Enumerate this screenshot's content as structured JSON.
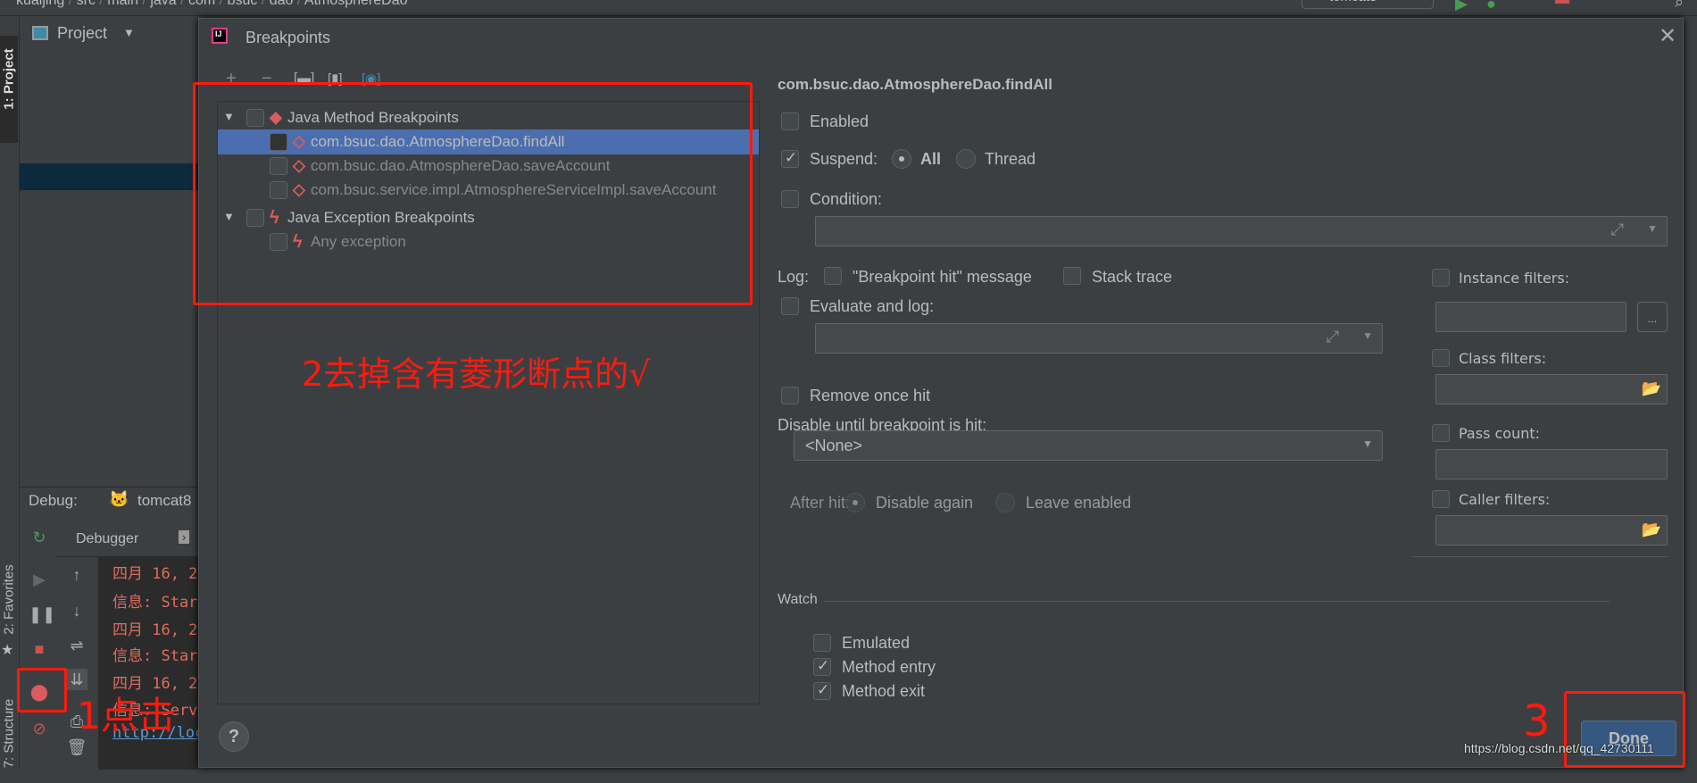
{
  "topbar": {
    "breadcrumb": [
      "kuaijing",
      "src",
      "main",
      "java",
      "com",
      "bsuc",
      "dao",
      "AtmosphereDao"
    ],
    "run_config": "tomcat8"
  },
  "left_stripe": {
    "project": "1: Project",
    "favorites": "2: Favorites",
    "structure": "7: Structure"
  },
  "project_panel": {
    "title": "Project"
  },
  "debug": {
    "label": "Debug:",
    "config": "tomcat8",
    "tab": "Debugger",
    "console": [
      "四月 16, 2",
      "信息: Star",
      "四月 16, 2",
      "信息: Star",
      "四月 16, 2",
      "信息: Serv",
      "http://loc"
    ]
  },
  "dialog": {
    "title": "Breakpoints",
    "tree": [
      {
        "label": "Java Method Breakpoints",
        "type": "group",
        "icon": "diamond-filled-icon",
        "checked": false
      },
      {
        "label": "com.bsuc.dao.AtmosphereDao.findAll",
        "type": "item",
        "icon": "diamond-outline-icon",
        "checked": false,
        "selected": true
      },
      {
        "label": "com.bsuc.dao.AtmosphereDao.saveAccount",
        "type": "item",
        "icon": "diamond-outline-icon",
        "checked": false
      },
      {
        "label": "com.bsuc.service.impl.AtmosphereServiceImpl.saveAccount",
        "type": "item",
        "icon": "diamond-outline-icon",
        "checked": false
      },
      {
        "label": "Java Exception Breakpoints",
        "type": "group",
        "icon": "lightning-icon",
        "checked": false
      },
      {
        "label": "Any exception",
        "type": "item",
        "icon": "lightning-icon",
        "checked": false
      }
    ],
    "detail": {
      "title": "com.bsuc.dao.AtmosphereDao.findAll",
      "enabled": "Enabled",
      "suspend": "Suspend:",
      "all": "All",
      "thread": "Thread",
      "condition": "Condition:",
      "log": "Log:",
      "bp_hit": "\"Breakpoint hit\" message",
      "stack_trace": "Stack trace",
      "evaluate": "Evaluate and log:",
      "remove_once": "Remove once hit",
      "disable_until": "Disable until breakpoint is hit:",
      "none": "<None>",
      "after_hit": "After hit:",
      "disable_again": "Disable again",
      "leave_enabled": "Leave enabled",
      "instance_filters": "Instance filters:",
      "ellipsis": "...",
      "class_filters": "Class filters:",
      "pass_count": "Pass count:",
      "caller_filters": "Caller filters:",
      "watch": "Watch",
      "emulated": "Emulated",
      "method_entry": "Method entry",
      "method_exit": "Method exit"
    },
    "done": "Done",
    "help": "?"
  },
  "annotations": {
    "step1": "1点击",
    "step2": "2去掉含有菱形断点的√",
    "step3": "3"
  },
  "watermark": "https://blog.csdn.net/qq_42730111",
  "colors": {
    "accent_red": "#ff1a0f",
    "selection": "#4b6eaf",
    "done_button": "#365880",
    "breakpoint": "#db5c5c"
  }
}
